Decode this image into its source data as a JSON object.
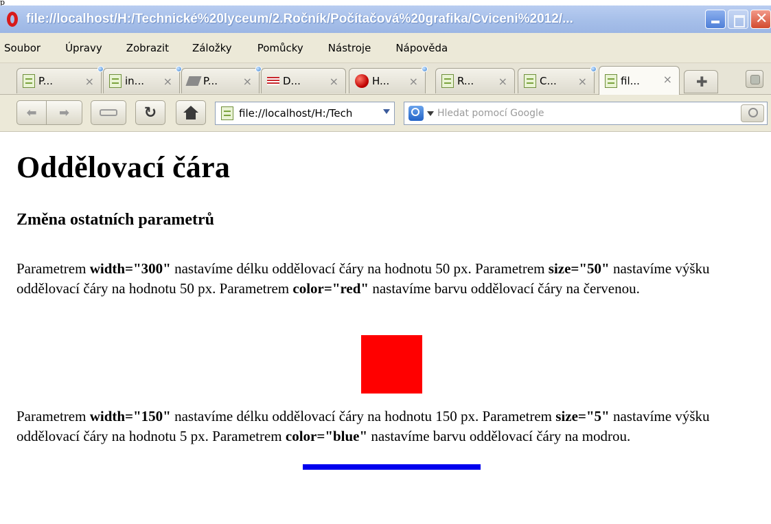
{
  "window": {
    "top_fragment": "p",
    "title": "file://localhost/H:/Technické%20lyceum/2.Ročník/Počítačová%20grafika/Cviceni%2012/..."
  },
  "menu": [
    "Soubor",
    "Úpravy",
    "Zobrazit",
    "Záložky",
    "Pomůcky",
    "Nástroje",
    "Nápověda"
  ],
  "tabs": [
    {
      "label": "P...",
      "icon": "page-icon"
    },
    {
      "label": "in...",
      "icon": "page-icon"
    },
    {
      "label": "P...",
      "icon": "book-icon"
    },
    {
      "label": "D...",
      "icon": "zive-icon"
    },
    {
      "label": "H...",
      "icon": "red-ball-icon"
    },
    {
      "label": "R...",
      "icon": "page-icon"
    },
    {
      "label": "C...",
      "icon": "page-icon"
    },
    {
      "label": "fil...",
      "icon": "page-icon",
      "active": true
    }
  ],
  "tab_close_glyph": "×",
  "navigation": {
    "address": "file://localhost/H:/Tech",
    "search_placeholder": "Hledat pomocí Google"
  },
  "content": {
    "heading": "Oddělovací čára",
    "subheading": "Změna ostatních parametrů",
    "paragraph1": {
      "t1": "Parametrem ",
      "b1": "width=\"300\"",
      "t2": " nastavíme délku oddělovací čáry na hodnotu 50 px. Parametrem ",
      "b2": "size=\"50\"",
      "t3": " nastavíme výšku oddělovací čáry na hodnotu 50 px. Parametrem ",
      "b3": "color=\"red\"",
      "t4": " nastavíme barvu oddělovací čáry na červenou."
    },
    "paragraph2": {
      "t1": "Parametrem ",
      "b1": "width=\"150\"",
      "t2": " nastavíme délku oddělovací čáry na hodnotu 150 px. Parametrem ",
      "b2": "size=\"5\"",
      "t3": " nastavíme výšku oddělovací čáry na hodnotu 5 px. Parametrem ",
      "b3": "color=\"blue\"",
      "t4": " nastavíme barvu oddělovací čáry na modrou."
    }
  },
  "colors": {
    "titlebar": "#a6bfe9",
    "chrome": "#ece9d8",
    "rule_red": "#ff0000",
    "rule_blue": "#0000ee"
  }
}
